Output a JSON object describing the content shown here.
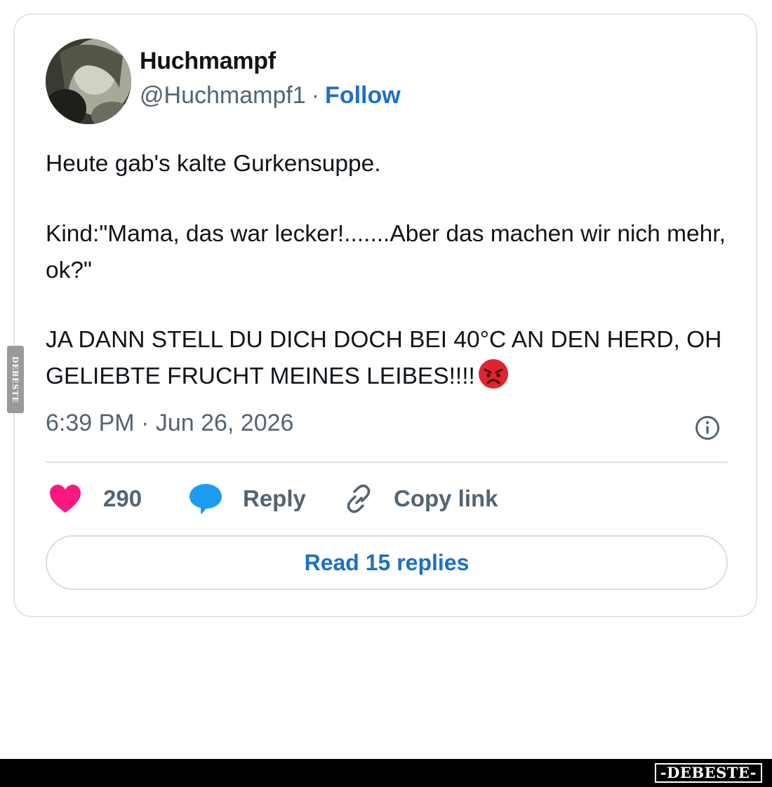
{
  "tweet": {
    "display_name": "Huchmampf",
    "handle": "@Huchmampf1",
    "separator": "·",
    "follow_label": "Follow",
    "text": {
      "line1": "Heute gab's kalte Gurkensuppe.",
      "line2": "Kind:\"Mama, das war lecker!.......Aber das machen wir nich mehr, ok?\"",
      "line3": "JA DANN STELL DU DICH DOCH BEI 40°C AN DEN HERD, OH GELIEBTE FRUCHT MEINES LEIBES!!!!",
      "emoji": "angry-face-emoji"
    },
    "timestamp": "6:39 PM · Jun 26, 2026",
    "info_icon": "info-icon"
  },
  "actions": {
    "like_icon": "heart-icon",
    "like_count": "290",
    "reply_icon": "speech-bubble-icon",
    "reply_label": "Reply",
    "copy_icon": "link-icon",
    "copy_label": "Copy link"
  },
  "read_replies_label": "Read 15 replies",
  "watermark": {
    "side_text": "DEBESTE",
    "footer_text": "-DEBESTE-"
  },
  "colors": {
    "link_blue": "#1d70c6",
    "heart_pink": "#f91880",
    "bubble_blue": "#1d9bf0",
    "muted_gray": "#536471",
    "angry_red": "#e0242f"
  }
}
